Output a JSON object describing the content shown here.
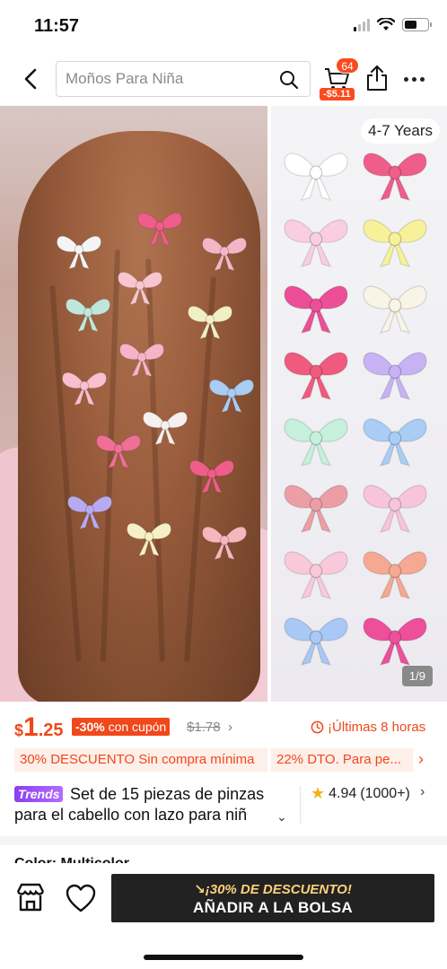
{
  "status_bar": {
    "time": "11:57"
  },
  "header": {
    "search_placeholder": "Moños Para Niña",
    "cart_count": "64",
    "cart_discount": "-$5.11"
  },
  "gallery": {
    "age_badge": "4-7 Years",
    "page_indicator": "1/9"
  },
  "price": {
    "currency": "$",
    "integer": "1",
    "decimal": ".25",
    "discount_percent": "-30%",
    "discount_suffix": "con cupón",
    "original_price": "$1.78",
    "countdown": "¡Últimas 8 horas"
  },
  "coupons": [
    "30% DESCUENTO Sin compra mínima",
    "22% DTO. Para pe..."
  ],
  "product": {
    "badge": "Trends",
    "title": "Set de 15 piezas de pinzas para el cabello con lazo para niñ",
    "rating": "4.94",
    "review_count": "(1000+)"
  },
  "color_label": "Color: Multicolor",
  "bottom_bar": {
    "promo": "¡30% DE DESCUENTO!",
    "add_label": "AÑADIR A LA BOLSA"
  },
  "colors": {
    "accent": "#f0481b",
    "badge_purple": "#8a3ff0",
    "dark_button": "#222222"
  },
  "icons": [
    "back-arrow-icon",
    "search-icon",
    "cart-icon",
    "share-icon",
    "more-icon",
    "clock-icon",
    "star-icon",
    "store-icon",
    "heart-icon"
  ]
}
